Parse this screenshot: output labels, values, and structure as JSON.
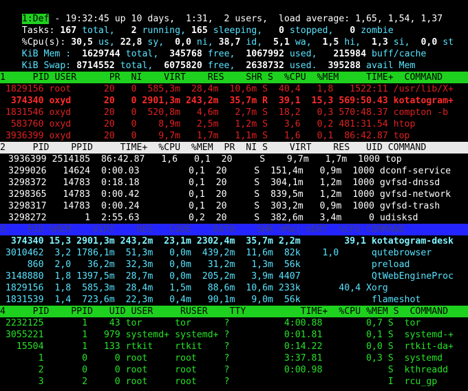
{
  "status": {
    "tab": "1:Def",
    "uptime": " - 19:32:45 up 10 days,  1:31,  2 users,  load average: 1,65, 1,54, 1,37",
    "tasks_label": "Tasks: ",
    "tasks_total": "167",
    "tasks_total_l": " total,   ",
    "tasks_running": "2",
    "tasks_running_l": " running, ",
    "tasks_sleeping": "165",
    "tasks_sleeping_l": " sleeping,   ",
    "tasks_stopped": "0",
    "tasks_stopped_l": " stopped,   ",
    "tasks_zombie": "0",
    "tasks_zombie_l": " zombie",
    "cpu_label": "%Cpu(s): ",
    "cpu_us": "30,5",
    "cpu_us_l": " us, ",
    "cpu_sy": "22,8",
    "cpu_sy_l": " sy,  ",
    "cpu_ni": "0,0",
    "cpu_ni_l": " ni, ",
    "cpu_id": "38,7",
    "cpu_id_l": " id,  ",
    "cpu_wa": "5,1",
    "cpu_wa_l": " wa,  ",
    "cpu_hi": "1,5",
    "cpu_hi_l": " hi,  ",
    "cpu_si": "1,3",
    "cpu_si_l": " si,  ",
    "cpu_st": "0,0",
    "cpu_st_l": " st",
    "mem_label": "KiB Mem : ",
    "mem_total": " 1629744",
    "mem_total_l": " total,  ",
    "mem_free": "345768",
    "mem_free_l": " free,  ",
    "mem_used": "1067992",
    "mem_used_l": " used,   ",
    "mem_buff": "215984",
    "mem_buff_l": " buff/cache",
    "swap_label": "KiB Swap: ",
    "swap_total": "8714552",
    "swap_total_l": " total,  ",
    "swap_free": "6075820",
    "swap_free_l": " free,  ",
    "swap_used": "2638732",
    "swap_used_l": " used.  ",
    "swap_avail": "395288",
    "swap_avail_l": " avail Mem"
  },
  "panel1": {
    "header": "1     PID USER      PR  NI    VIRT    RES    SHR S  %CPU  %MEM     TIME+  COMMAND   ",
    "rows": [
      {
        "text": " 1829156 root      20   0  585,3m  28,4m  10,6m S  40,4   1,8   1522:11 /usr/lib/X+",
        "cls": "c-red"
      },
      {
        "text": "  374340 oxyd      20   0 2901,3m 243,2m  35,7m R  39,1  15,3 569:50.43 kotatogram+",
        "cls": "c-redb"
      },
      {
        "text": " 1831546 oxyd      20   0  520,8m   4,6m   2,7m S  18,2   0,3 570:48.37 compton -b",
        "cls": "c-red"
      },
      {
        "text": "  583760 oxyd      20   0    8,9m   2,5m   1,2m S   3,6   0,2 481:31.54 htop      ",
        "cls": "c-red"
      },
      {
        "text": " 3936399 oxyd      20   0    9,7m   1,7m   1,1m S   1,6   0,1  86:42.87 top       ",
        "cls": "c-red"
      }
    ]
  },
  "panel2": {
    "header": "2     PID    PPID     TIME+  %CPU  %MEM  PR  NI S    VIRT    RES   UID COMMAND      ",
    "rows": [
      {
        "text": "3936399 2514185  86:42.87   1,6   0,1  20     S    9,7m   1,7m  1000 top          ",
        "cls": "c-white"
      },
      {
        "text": "3299026   14624  0:00.03         0,1  20     S  151,4m   0,9m  1000 dconf-service",
        "cls": "c-white"
      },
      {
        "text": "3298372   14783  0:18.18         0,1  20     S  304,1m   1,2m  1000 gvfsd-dnssd  ",
        "cls": "c-white"
      },
      {
        "text": "3298365   14783  0:00.42         0,1  20     S  839,5m   1,2m  1000 gvfsd-network",
        "cls": "c-white"
      },
      {
        "text": "3298317   14783  0:00.24         0,1  20     S  303,2m   0,9m  1000 gvfsd-trash  ",
        "cls": "c-white"
      },
      {
        "text": "3298272       1  2:55.63         0,2  20     S  382,6m   3,4m     0 udisksd      ",
        "cls": "c-white"
      }
    ]
  },
  "panel3": {
    "header": "3    PID %MEM    VIRT    RES   CODE    DATA    SHR nMaj nDRT  %CPU COMMAND          ",
    "rows": [
      {
        "text": "  374340 15,3 2901,3m 243,2m  23,1m 2302,4m  35,7m 2,2m        39,1 kotatogram-desk",
        "cls": "c-cyanb"
      },
      {
        "text": " 3010462  3,2 1786,1m  51,3m   0,0m  439,2m  11,6m  82k    1,0      qutebrowser  ",
        "cls": "c-cyan"
      },
      {
        "text": "     860  2,0   36,2m  32,3m   0,0m   31,2m   1,3m  56k             preload      ",
        "cls": "c-cyan"
      },
      {
        "text": " 3148880  1,8 1397,5m  28,7m   0,0m  205,2m   3,9m 4407             QtWebEngineProc",
        "cls": "c-cyan"
      },
      {
        "text": " 1829156  1,8  585,3m  28,4m   1,5m   88,6m  10,6m 233k       40,4 Xorg          ",
        "cls": "c-cyan"
      },
      {
        "text": " 1831539  1,4  723,6m  22,3m   0,4m   90,1m   9,0m  56k             flameshot    ",
        "cls": "c-cyan"
      }
    ]
  },
  "panel4": {
    "header": "4     PID    PPID   UID USER     RUSER    TTY          TIME+  %CPU %MEM S  COMMAND    ",
    "rows": [
      {
        "text": " 2232125       1    43 tor      tor      ?          4:00.88        0,7 S  tor       ",
        "cls": "c-green"
      },
      {
        "text": " 3055221       1   979 systemd+ systemd+ ?          0:01.81        0,1 S  systemd-+ ",
        "cls": "c-green"
      },
      {
        "text": "   15504       1   133 rtkit    rtkit    ?          0:14.22        0,0 S  rtkit-da+ ",
        "cls": "c-green"
      },
      {
        "text": "       1       0     0 root     root     ?          3:37.81        0,3 S  systemd   ",
        "cls": "c-green"
      },
      {
        "text": "       2       0     0 root     root     ?          0:00.98            S  kthreadd  ",
        "cls": "c-green"
      },
      {
        "text": "       3       2     0 root     root     ?                             I  rcu_gp    ",
        "cls": "c-green"
      }
    ]
  }
}
